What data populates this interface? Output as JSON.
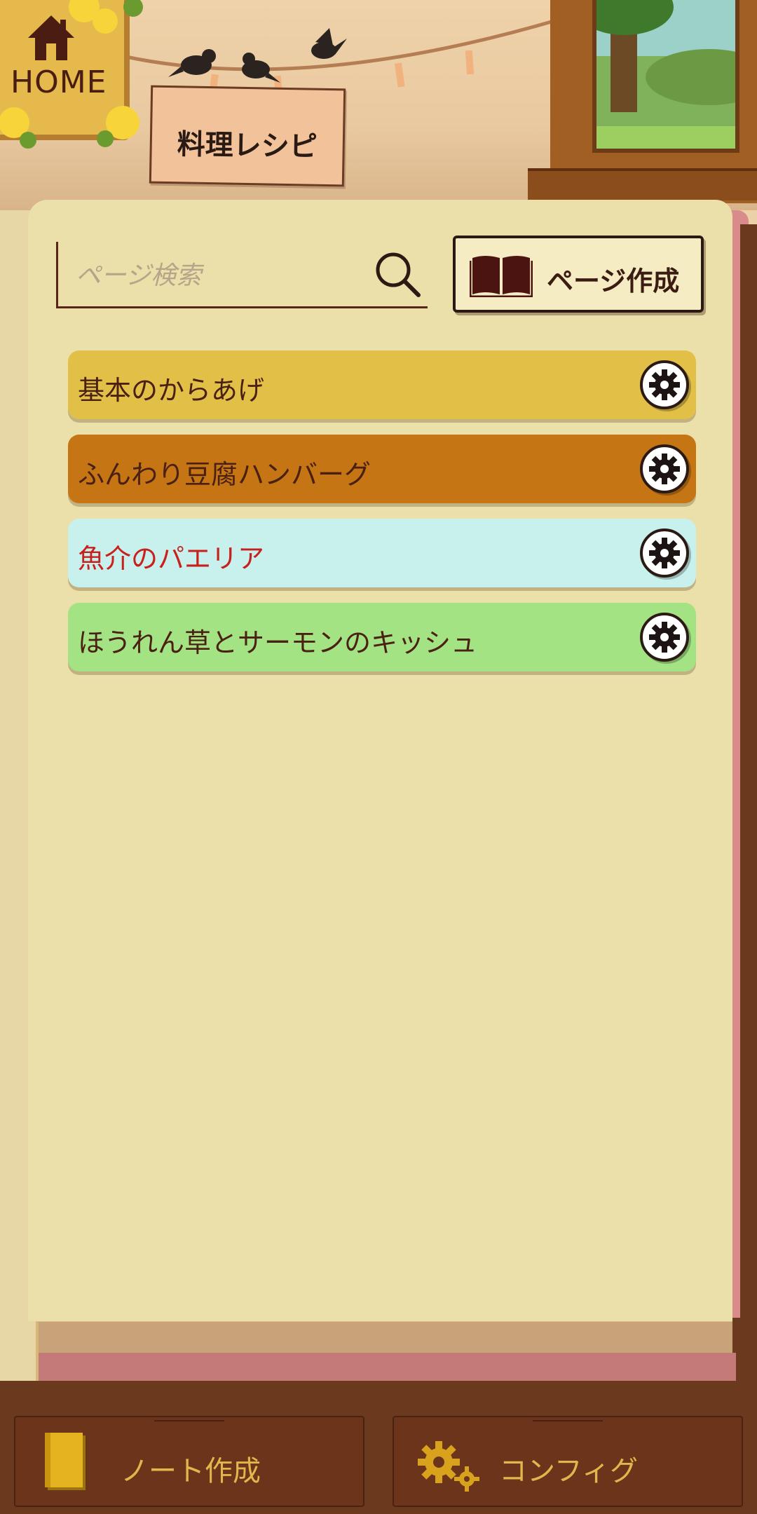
{
  "header": {
    "home_label": "HOME",
    "category_sign": "料理レシピ"
  },
  "toolbar": {
    "search_placeholder": "ページ検索",
    "create_page_label": "ページ作成"
  },
  "recipes": [
    {
      "title": "基本のからあげ",
      "color": "#e2c048",
      "text_color": "#4a2013"
    },
    {
      "title": "ふんわり豆腐ハンバーグ",
      "color": "#c57514",
      "text_color": "#4a2013"
    },
    {
      "title": "魚介のパエリア",
      "color": "#c8f1ed",
      "text_color": "#c8201c"
    },
    {
      "title": "ほうれん草とサーモンのキッシュ",
      "color": "#a3e383",
      "text_color": "#4a2013"
    }
  ],
  "bottom_bar": {
    "create_note_label": "ノート作成",
    "config_label": "コンフィグ"
  },
  "icons": {
    "home": "house-icon",
    "search": "magnifier-icon",
    "create_page": "open-book-icon",
    "settings": "gear-icon",
    "note": "notebook-icon",
    "config": "gears-icon"
  }
}
